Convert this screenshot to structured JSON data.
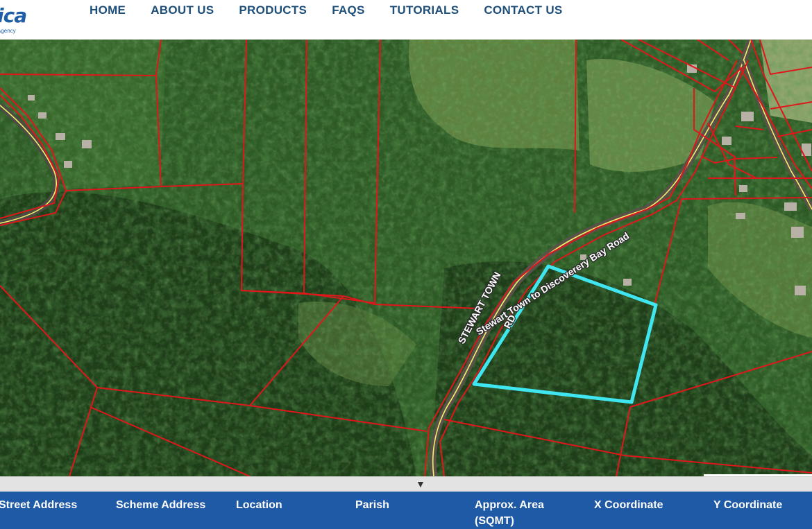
{
  "logo": {
    "text": "ica",
    "subtitle": "Agency"
  },
  "nav": {
    "items": [
      "HOME",
      "ABOUT US",
      "PRODUCTS",
      "FAQS",
      "TUTORIALS",
      "CONTACT US"
    ]
  },
  "map": {
    "road_label_main": "Stewart Town to Discoverery Bay Road",
    "road_label_side": "STEWART TOWN",
    "road_label_rd": "RD",
    "parcel_boundary_color": "#e0161b",
    "selected_parcel_color": "#3fe6f0",
    "road_color": "#f2f06a"
  },
  "collapse": {
    "arrow": "▼"
  },
  "table": {
    "columns": [
      "Street Address",
      "Scheme Address",
      "Location",
      "Parish",
      "Approx. Area",
      "(SQMT)",
      "X Coordinate",
      "Y Coordinate"
    ]
  }
}
